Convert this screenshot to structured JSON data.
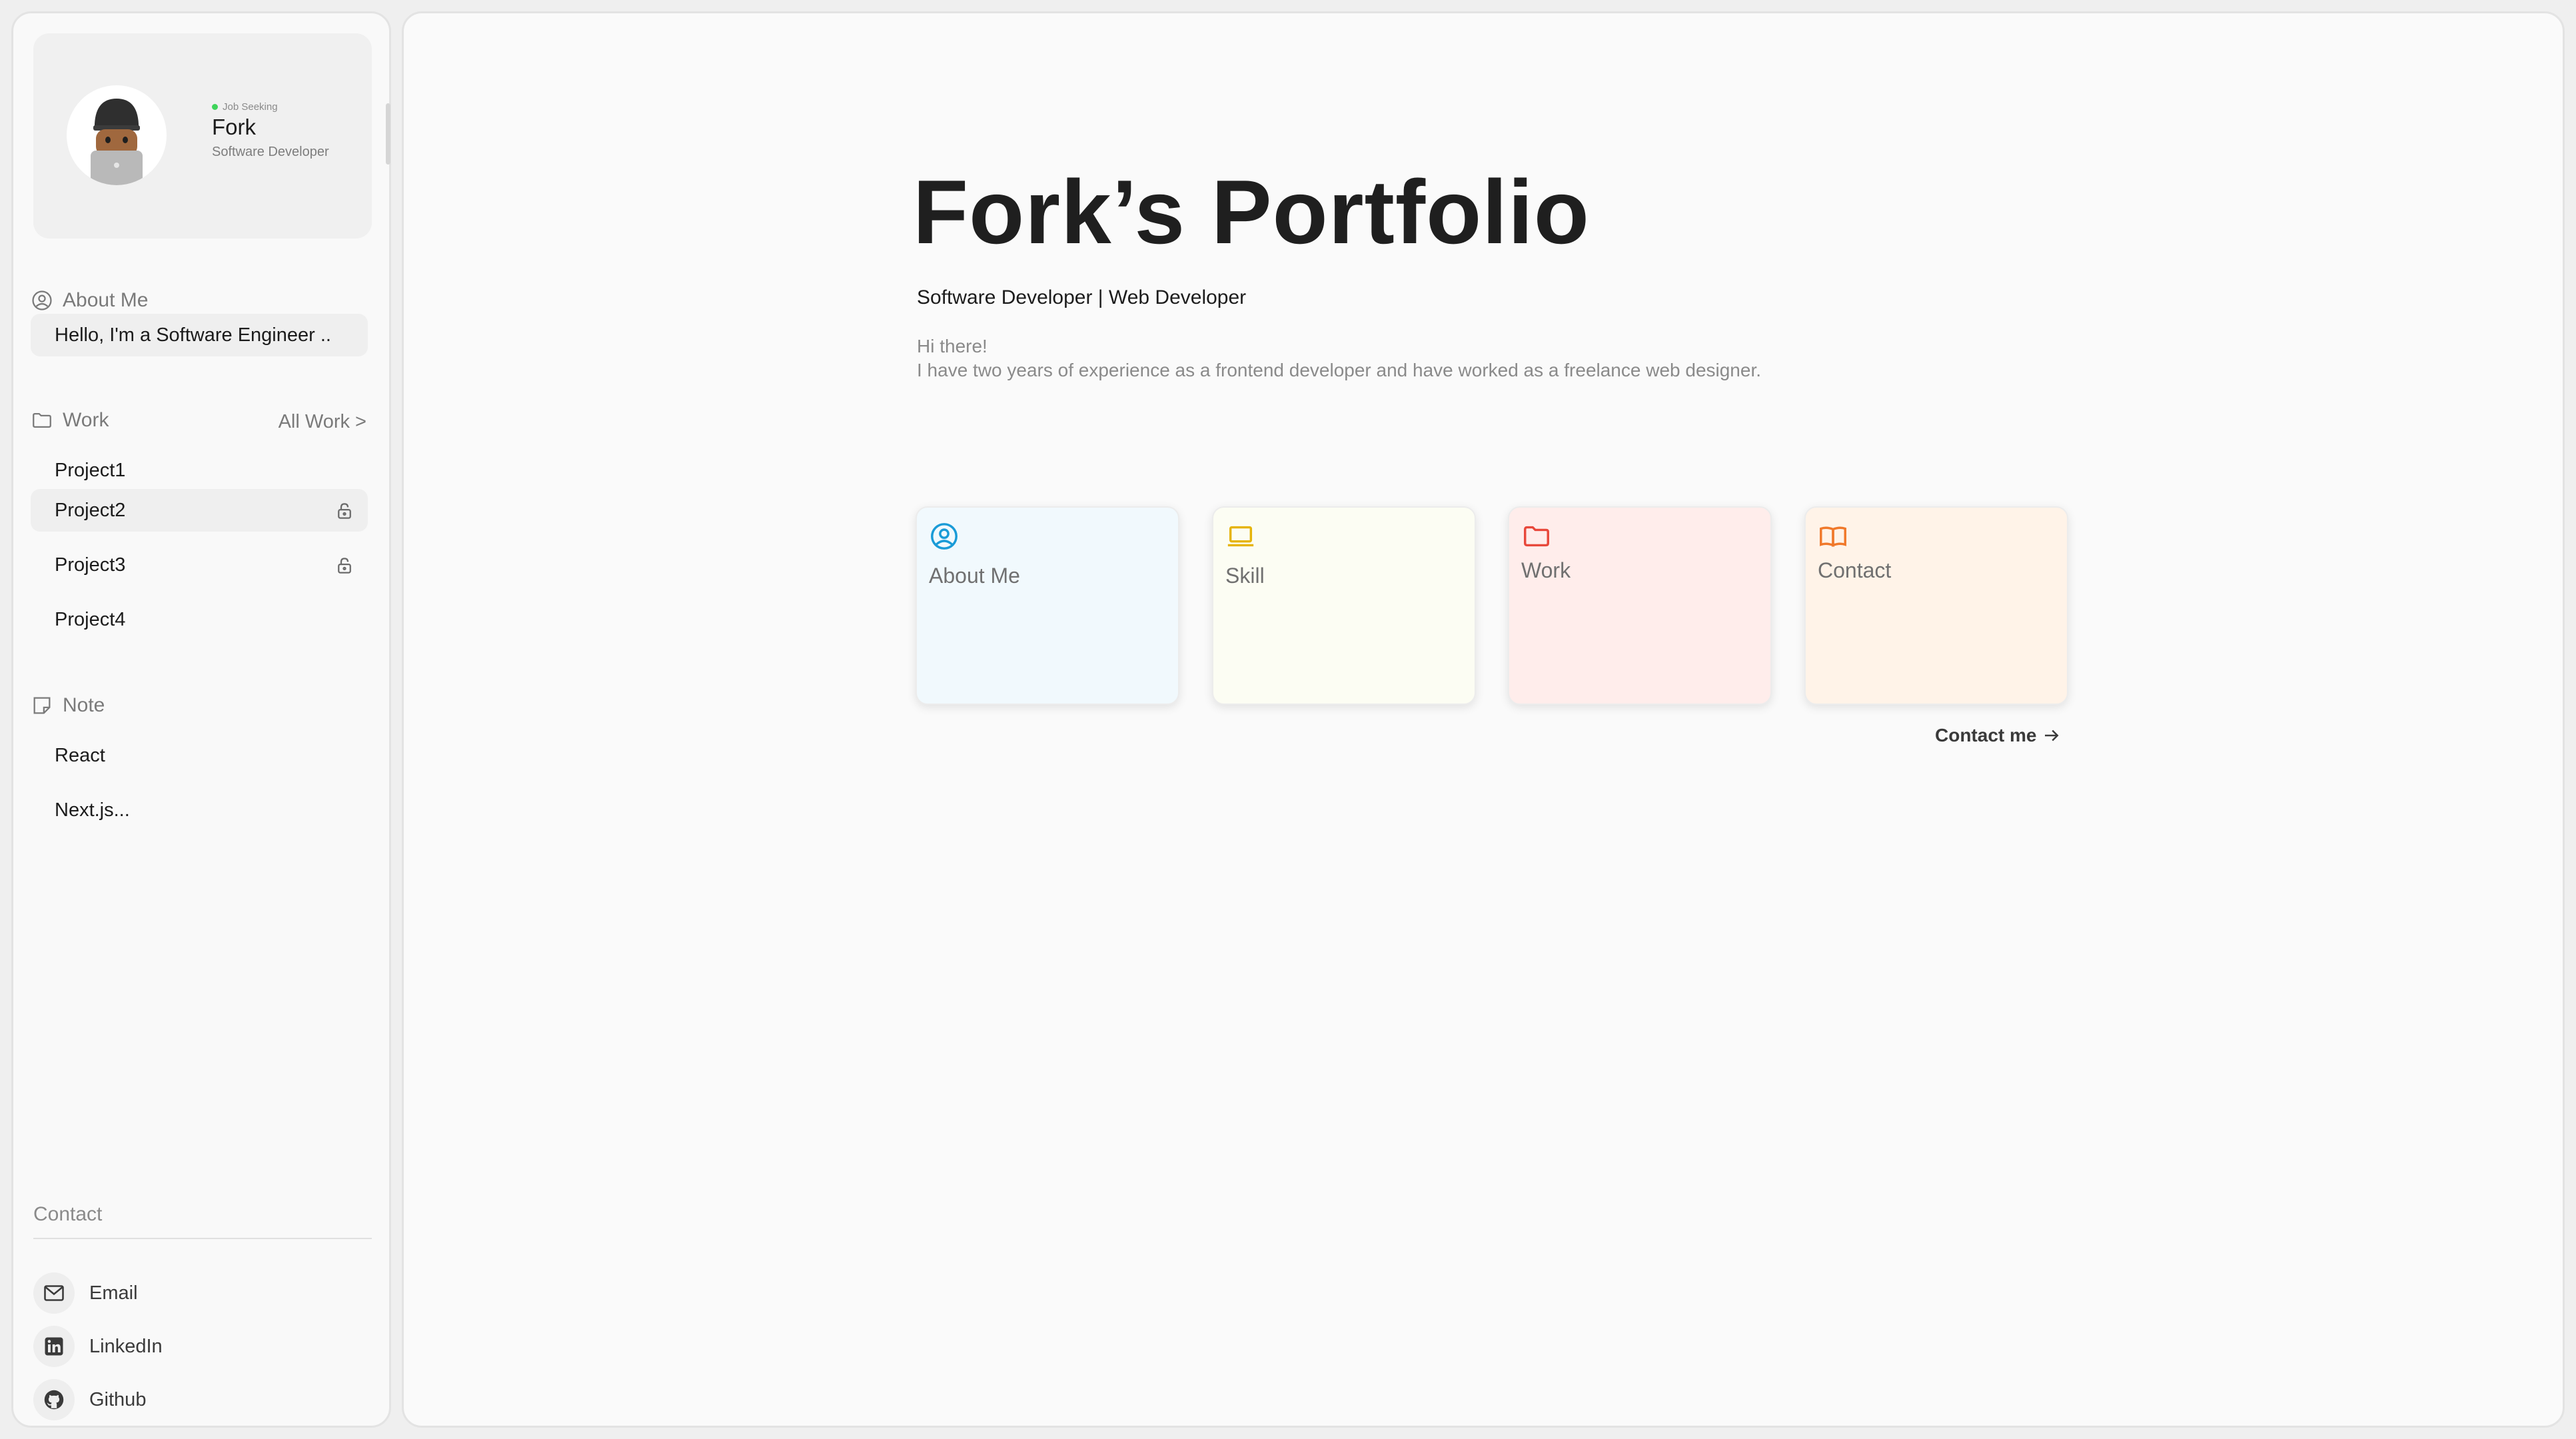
{
  "profile": {
    "status": "Job Seeking",
    "name": "Fork",
    "role": "Software Developer"
  },
  "sidebar": {
    "about": {
      "heading": "About Me",
      "preview": "Hello, I'm a Software Engineer .."
    },
    "work": {
      "heading": "Work",
      "all_link": "All Work >",
      "items": [
        {
          "label": "Project1",
          "locked": false
        },
        {
          "label": "Project2",
          "locked": true
        },
        {
          "label": "Project3",
          "locked": true
        },
        {
          "label": "Project4",
          "locked": false
        }
      ]
    },
    "note": {
      "heading": "Note",
      "items": [
        {
          "label": "React"
        },
        {
          "label": "Next.js..."
        }
      ]
    },
    "contact": {
      "heading": "Contact",
      "items": [
        {
          "label": "Email",
          "icon": "mail-icon"
        },
        {
          "label": "LinkedIn",
          "icon": "linkedin-icon"
        },
        {
          "label": "Github",
          "icon": "github-icon"
        }
      ]
    }
  },
  "main": {
    "title": "Fork’s Portfolio",
    "subtitle": "Software Developer | Web Developer",
    "intro_line1": "Hi there!",
    "intro_line2": "I have two years of experience as a frontend developer and have worked as a freelance web designer.",
    "cards": [
      {
        "label": "About Me",
        "icon": "user-circle-icon",
        "bg": "#f1f9fd",
        "accent": "#1a9bd7"
      },
      {
        "label": "Skill",
        "icon": "laptop-icon",
        "bg": "#fcfdf3",
        "accent": "#e6b40a"
      },
      {
        "label": "Work",
        "icon": "folder-icon",
        "bg": "#ffedeb",
        "accent": "#e8483b"
      },
      {
        "label": "Contact",
        "icon": "book-open-icon",
        "bg": "#fff3e8",
        "accent": "#f0782a"
      }
    ],
    "contact_link": "Contact me"
  },
  "colors": {
    "status_dot": "#3ed45a",
    "accent_about": "#1a9bd7",
    "accent_skill": "#e6b40a",
    "accent_work": "#e8483b",
    "accent_contact": "#f0782a"
  }
}
